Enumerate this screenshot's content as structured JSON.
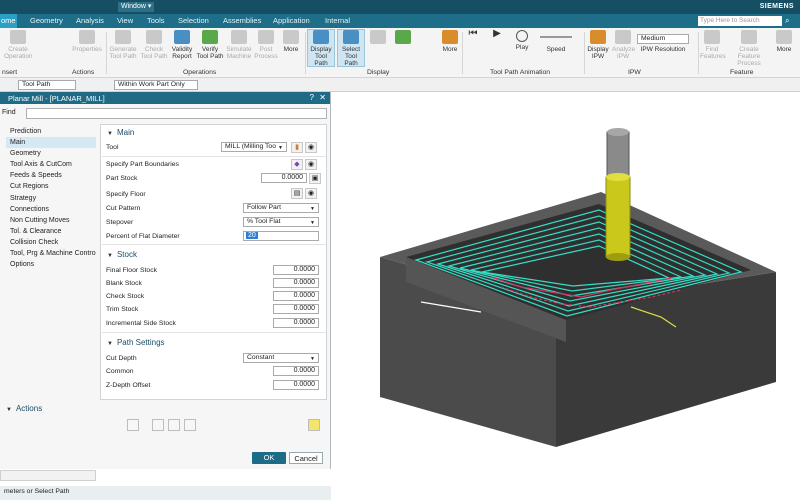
{
  "window": {
    "menu_label": "Window ▾",
    "brand": "SIEMENS"
  },
  "menu": {
    "home": "ome",
    "tabs": [
      "Geometry",
      "Analysis",
      "View",
      "Tools",
      "Selection",
      "Assemblies",
      "Application",
      "Internal"
    ],
    "search_placeholder": "Type Here to Search"
  },
  "ribbon": {
    "groups": {
      "insert": "nsert",
      "actions": "Actions",
      "operations": "Operations",
      "display": "Display",
      "animation": "Tool Path Animation",
      "ipw": "IPW",
      "feature": "Feature"
    },
    "buttons": {
      "create_operation": "Create Operation",
      "properties": "Properties",
      "generate_tool_path": "Generate Tool Path",
      "check_tool_path": "Check Tool Path",
      "validity_report": "Validity Report",
      "verify_tool_path": "Verify Tool Path",
      "simulate_machine": "Simulate Machine",
      "post_process": "Post Process",
      "more": "More",
      "display_tool_path": "Display Tool Path",
      "select_tool_path": "Select Tool Path",
      "more2": "More",
      "play": "Play",
      "speed": "Speed",
      "display_ipw": "Display IPW",
      "analyze_ipw": "Analyze IPW",
      "ipw_medium": "Medium",
      "ipw_resolution": "IPW Resolution",
      "find_features": "Find Features",
      "create_feature_process": "Create Feature Process",
      "more3": "More"
    }
  },
  "filterbar": {
    "type_filter": "Tool Path",
    "scope_filter": "Within Work Part Only"
  },
  "dialog": {
    "title": "Planar Mill - [PLANAR_MILL]",
    "find_label": "Find",
    "nav": [
      "Prediction",
      "Main",
      "Geometry",
      "Tool Axis & CutCom",
      "Feeds & Speeds",
      "Cut Regions",
      "Strategy",
      "Connections",
      "Non Cutting Moves",
      "Tol. & Clearance",
      "Collision Check",
      "Tool, Prg & Machine Control",
      "Options"
    ],
    "main": {
      "header": "Main",
      "tool_label": "Tool",
      "tool_value": "MILL (Milling Too",
      "boundaries_label": "Specify Part Boundaries",
      "part_stock_label": "Part Stock",
      "part_stock_value": "0.0000",
      "floor_label": "Specify Floor",
      "cut_pattern_label": "Cut Pattern",
      "cut_pattern_value": "Follow Part",
      "stepover_label": "Stepover",
      "stepover_value": "% Tool Flat",
      "flat_diam_label": "Percent of Flat Diameter",
      "flat_diam_value": "20"
    },
    "stock": {
      "header": "Stock",
      "rows": [
        {
          "label": "Final Floor Stock",
          "value": "0.0000"
        },
        {
          "label": "Blank Stock",
          "value": "0.0000"
        },
        {
          "label": "Check Stock",
          "value": "0.0000"
        },
        {
          "label": "Trim Stock",
          "value": "0.0000"
        },
        {
          "label": "Incremental Side Stock",
          "value": "0.0000"
        }
      ]
    },
    "path": {
      "header": "Path Settings",
      "cut_depth_label": "Cut Depth",
      "cut_depth_value": "Constant",
      "common_label": "Common",
      "common_value": "0.0000",
      "zdepth_label": "Z-Depth Offset",
      "zdepth_value": "0.0000"
    },
    "actions_header": "Actions",
    "ok": "OK",
    "cancel": "Cancel"
  },
  "status": "meters or Select Path",
  "colors": {
    "accent": "#1f6b86",
    "toolpath": "#34e0c8",
    "part": "#4a4a4a",
    "tool": "#c9c81b"
  }
}
